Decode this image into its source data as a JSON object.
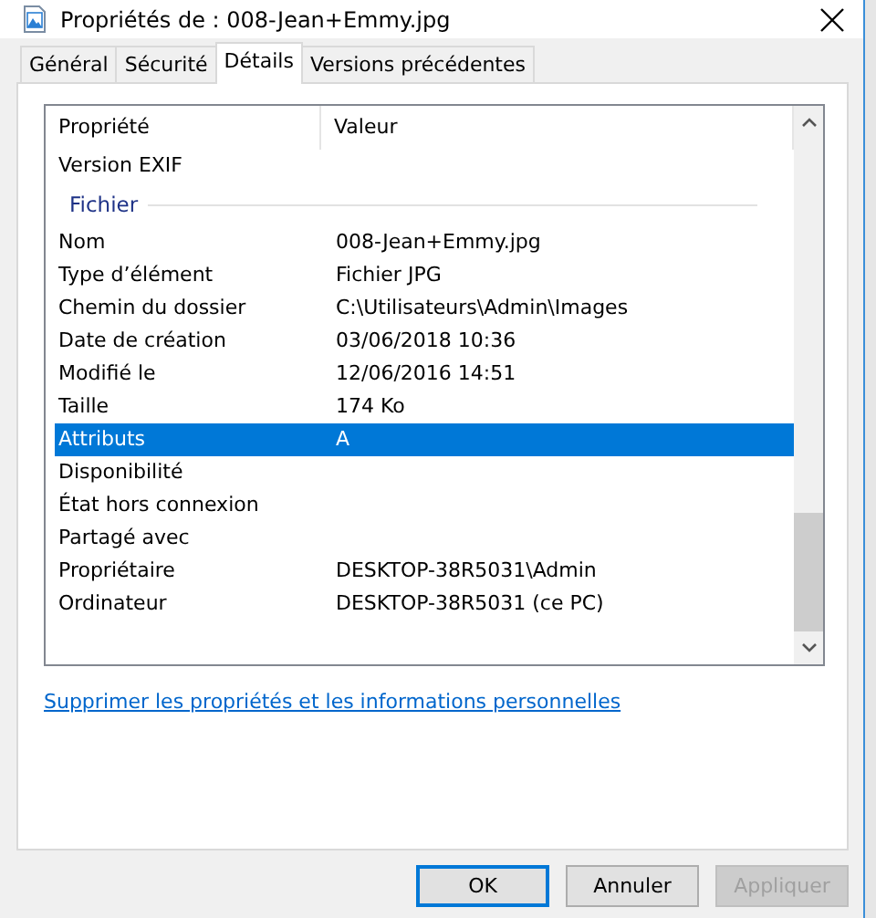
{
  "window": {
    "title": "Propriétés de : 008-Jean+Emmy.jpg"
  },
  "tabs": [
    {
      "label": "Général",
      "selected": false
    },
    {
      "label": "Sécurité",
      "selected": false
    },
    {
      "label": "Détails",
      "selected": true
    },
    {
      "label": "Versions précédentes",
      "selected": false
    }
  ],
  "table": {
    "columns": [
      "Propriété",
      "Valeur"
    ],
    "rows": [
      {
        "kind": "property",
        "name": "Version EXIF",
        "value": "",
        "selected": false
      },
      {
        "kind": "group",
        "name": "Fichier"
      },
      {
        "kind": "property",
        "name": "Nom",
        "value": "008-Jean+Emmy.jpg",
        "selected": false
      },
      {
        "kind": "property",
        "name": "Type d’élément",
        "value": "Fichier JPG",
        "selected": false
      },
      {
        "kind": "property",
        "name": "Chemin du dossier",
        "value": "C:\\Utilisateurs\\Admin\\Images",
        "selected": false
      },
      {
        "kind": "property",
        "name": "Date de création",
        "value": "03/06/2018 10:36",
        "selected": false
      },
      {
        "kind": "property",
        "name": "Modifié le",
        "value": "12/06/2016 14:51",
        "selected": false
      },
      {
        "kind": "property",
        "name": "Taille",
        "value": "174 Ko",
        "selected": false
      },
      {
        "kind": "property",
        "name": "Attributs",
        "value": "A",
        "selected": true
      },
      {
        "kind": "property",
        "name": "Disponibilité",
        "value": "",
        "selected": false
      },
      {
        "kind": "property",
        "name": "État hors connexion",
        "value": "",
        "selected": false
      },
      {
        "kind": "property",
        "name": "Partagé avec",
        "value": "",
        "selected": false
      },
      {
        "kind": "property",
        "name": "Propriétaire",
        "value": "DESKTOP-38R5031\\Admin",
        "selected": false
      },
      {
        "kind": "property",
        "name": "Ordinateur",
        "value": "DESKTOP-38R5031 (ce PC)",
        "selected": false
      }
    ]
  },
  "link": "Supprimer les propriétés et les informations personnelles",
  "buttons": [
    {
      "label": "OK",
      "default": true,
      "disabled": false
    },
    {
      "label": "Annuler",
      "default": false,
      "disabled": false
    },
    {
      "label": "Appliquer",
      "default": false,
      "disabled": true
    }
  ]
}
